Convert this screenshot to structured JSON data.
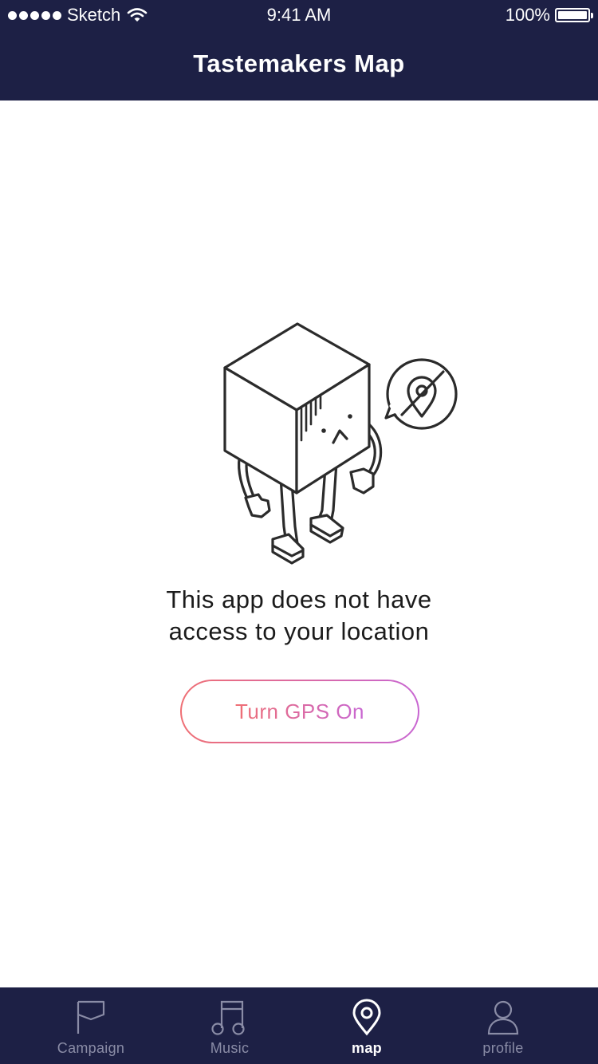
{
  "status_bar": {
    "carrier": "Sketch",
    "time": "9:41 AM",
    "battery": "100%"
  },
  "header": {
    "title": "Tastemakers Map"
  },
  "empty_state": {
    "message_line1": "This app does not have",
    "message_line2": "access to your location",
    "button_label": "Turn GPS On",
    "illustration": "sad-cube-character-location-disabled"
  },
  "tabs": [
    {
      "label": "Campaign",
      "icon": "flag-icon",
      "active": false
    },
    {
      "label": "Music",
      "icon": "music-note-icon",
      "active": false
    },
    {
      "label": "map",
      "icon": "map-pin-icon",
      "active": true
    },
    {
      "label": "profile",
      "icon": "user-icon",
      "active": false
    }
  ],
  "colors": {
    "nav_background": "#1d2045",
    "button_gradient_start": "#ef6f74",
    "button_gradient_end": "#c866d2",
    "tab_inactive": "#8a8ca6",
    "tab_active": "#ffffff"
  }
}
